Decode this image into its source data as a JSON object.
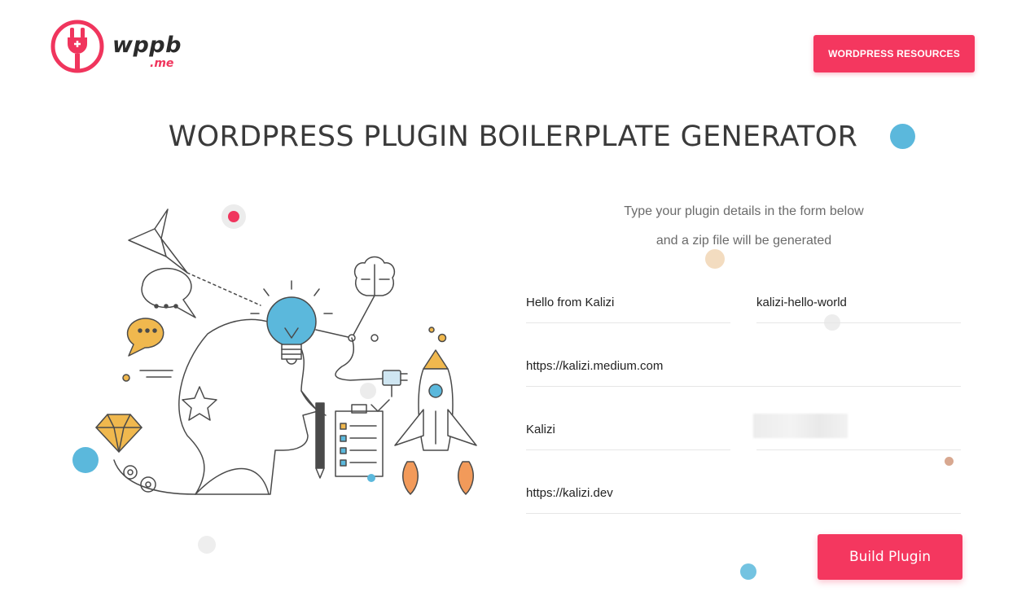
{
  "logo": {
    "name": "wppb",
    "suffix": ".me"
  },
  "header": {
    "resources_label": "WORDPRESS RESOURCES"
  },
  "page": {
    "title": "WORDPRESS PLUGIN BOILERPLATE GENERATOR"
  },
  "intro": {
    "line1": "Type your plugin details in the form below",
    "line2": "and a zip file will be generated"
  },
  "form": {
    "plugin_name": "Hello from Kalizi",
    "plugin_slug": "kalizi-hello-world",
    "plugin_uri": "https://kalizi.medium.com",
    "author_name": "Kalizi",
    "author_email": "",
    "author_uri": "https://kalizi.dev",
    "build_label": "Build Plugin"
  },
  "colors": {
    "accent": "#f4375f",
    "blue": "#5bb8dc",
    "orange": "#f0b84e"
  }
}
